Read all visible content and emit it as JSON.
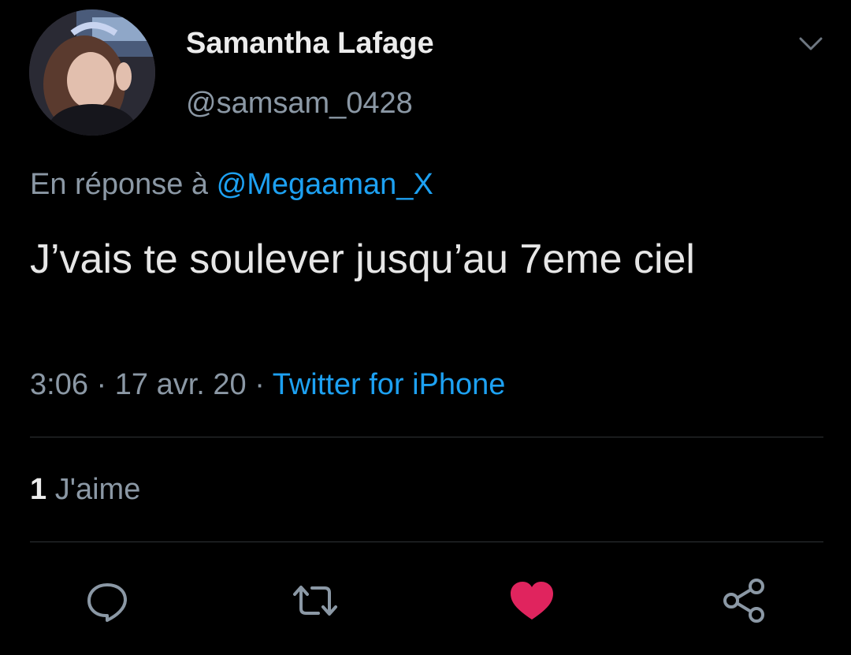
{
  "tweet": {
    "author": {
      "display_name": "Samantha Lafage",
      "handle": "@samsam_0428"
    },
    "reply_to": {
      "prefix": "En réponse à",
      "mention": "@Megaaman_X"
    },
    "text": "J’vais te soulever jusqu’au 7eme ciel",
    "meta": {
      "time": "3:06",
      "separator": "·",
      "date": "17 avr. 20",
      "source": "Twitter for iPhone"
    },
    "likes": {
      "count": "1",
      "label": "J'aime"
    },
    "liked": true,
    "icons": {
      "more": "chevron-down-icon",
      "reply": "speech-bubble-icon",
      "retweet": "retweet-icon",
      "like": "heart-icon",
      "share": "share-icon"
    },
    "colors": {
      "background": "#000000",
      "link": "#1da1f2",
      "muted": "#8b98a5",
      "like": "#e0245e",
      "divider": "#2f3336"
    }
  }
}
